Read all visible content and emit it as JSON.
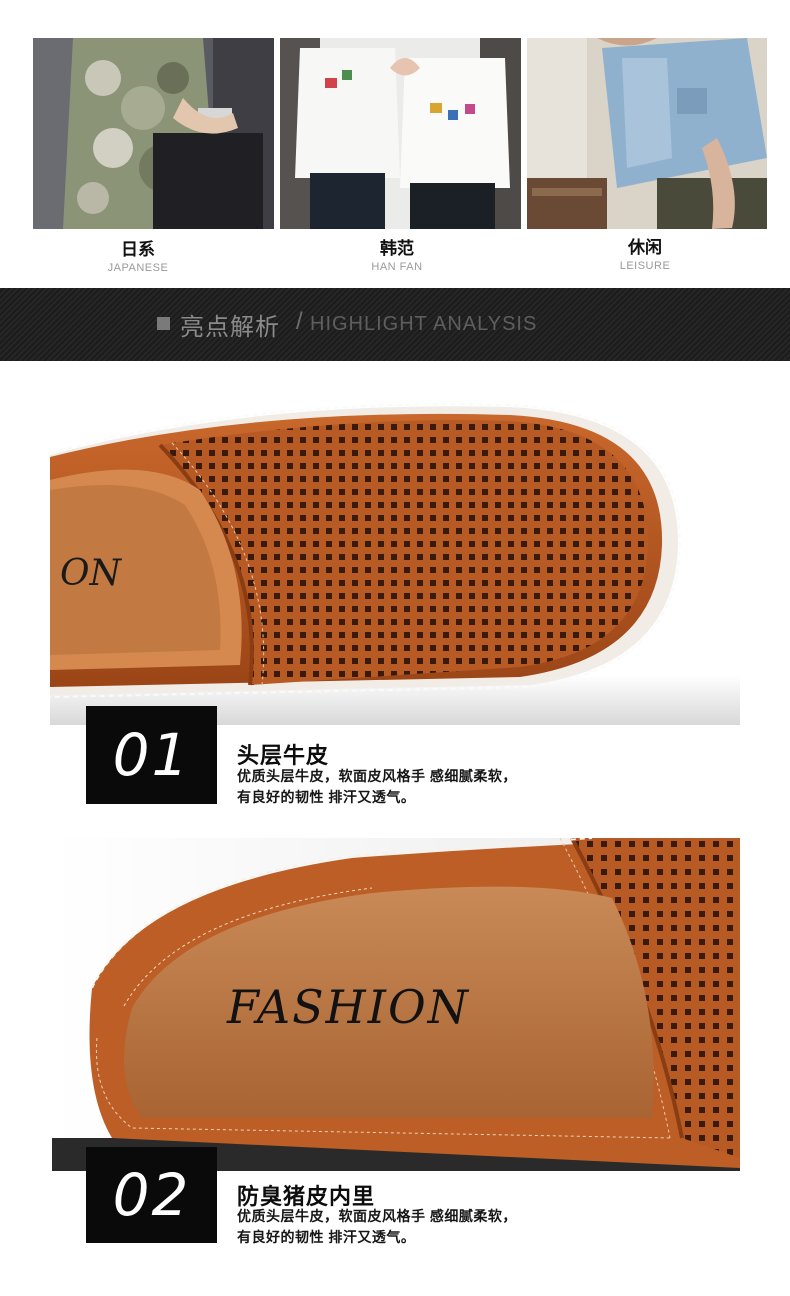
{
  "styles": [
    {
      "title": "日系",
      "subtitle": "JAPANESE"
    },
    {
      "title": "韩范",
      "subtitle": "HAN FAN"
    },
    {
      "title": "休闲",
      "subtitle": "LEISURE"
    }
  ],
  "banner": {
    "title": "亮点解析",
    "separator": "/",
    "subtitle": "HIGHLIGHT ANALYSIS"
  },
  "shoe_insole_text": "FASHION",
  "features": [
    {
      "number": "01",
      "title": "头层牛皮",
      "line1": "优质头层牛皮，软面皮风格手 感细腻柔软，",
      "line2": "有良好的韧性 排汗又透气。"
    },
    {
      "number": "02",
      "title": "防臭猪皮内里",
      "line1": "优质头层牛皮，软面皮风格手 感细腻柔软，",
      "line2": "有良好的韧性 排汗又透气。"
    }
  ],
  "colors": {
    "leather": "#b8551f",
    "banner": "#222222",
    "number_box": "#0a0a0a"
  }
}
